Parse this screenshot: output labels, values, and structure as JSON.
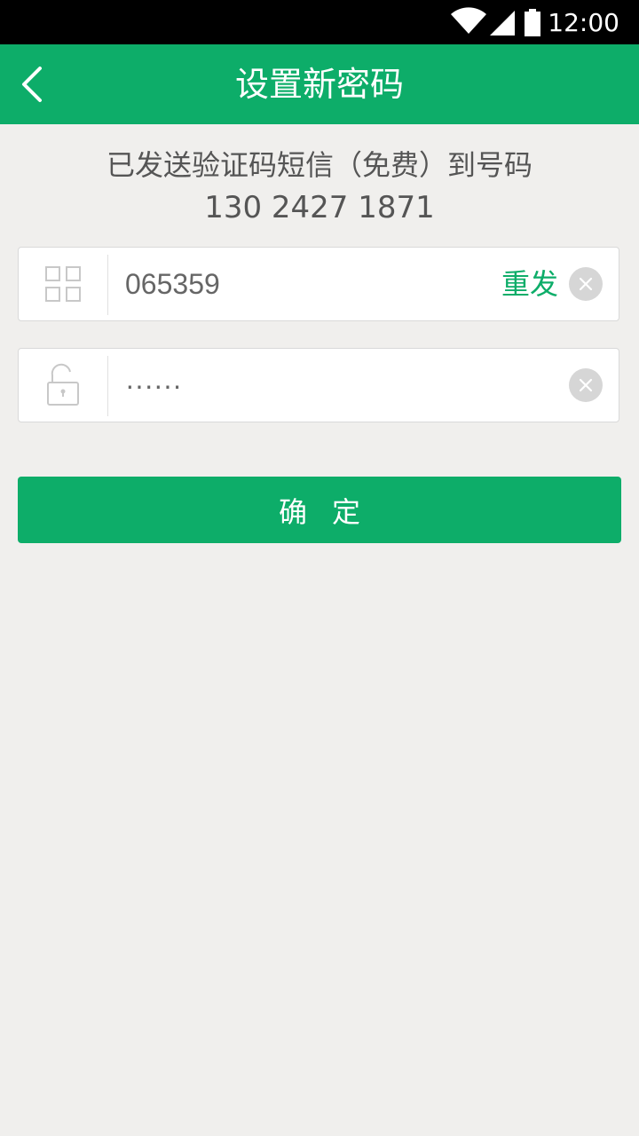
{
  "status_bar": {
    "time": "12:00"
  },
  "app_bar": {
    "title": "设置新密码",
    "back_icon": "chevron-left-icon"
  },
  "info": {
    "message": "已发送验证码短信（免费）到号码",
    "phone": "130 2427 1871"
  },
  "code_field": {
    "icon": "grid-icon",
    "value": "065359",
    "resend_label": "重发"
  },
  "password_field": {
    "icon": "unlock-icon",
    "value": "······"
  },
  "confirm_button": {
    "label": "确定"
  },
  "colors": {
    "primary": "#0dad69",
    "background": "#f0efed",
    "status_bar": "#000000"
  }
}
